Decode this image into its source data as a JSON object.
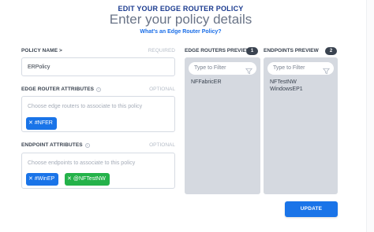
{
  "header": {
    "title": "EDIT YOUR EDGE ROUTER POLICY",
    "subtitle": "Enter your policy details",
    "help_link": "What's an Edge Router Policy?"
  },
  "form": {
    "policy_name": {
      "label": "POLICY NAME >",
      "hint": "REQUIRED",
      "value": "ERPolicy"
    },
    "edge_router_attributes": {
      "label": "EDGE ROUTER ATTRIBUTES",
      "hint": "OPTIONAL",
      "placeholder": "Choose edge routers to associate to this policy",
      "chips": [
        {
          "label": "#NFER",
          "color": "#1a74e8"
        }
      ]
    },
    "endpoint_attributes": {
      "label": "ENDPOINT ATTRIBUTES",
      "hint": "OPTIONAL",
      "placeholder": "Choose endpoints to associate to this policy",
      "chips": [
        {
          "label": "#WinEP",
          "color": "#1a74e8"
        },
        {
          "label": "@NFTestNW",
          "color": "#24b24a"
        }
      ]
    }
  },
  "previews": {
    "edge_routers": {
      "title": "EDGE ROUTERS PREVIEW",
      "count": "1",
      "filter_placeholder": "Type to Filter",
      "items": [
        "NFFabricER"
      ]
    },
    "endpoints": {
      "title": "ENDPOINTS PREVIEW",
      "count": "2",
      "filter_placeholder": "Type to Filter",
      "items": [
        "NFTestNW",
        "WindowsEP1"
      ]
    }
  },
  "actions": {
    "update_label": "UPDATE"
  },
  "colors": {
    "accent": "#1a74e8",
    "green_chip": "#24b24a",
    "panel_bg": "#d5d9e0",
    "title_blue": "#1a3a8f"
  },
  "icons": {
    "info": "info-icon",
    "close": "close-icon",
    "filter": "filter-icon"
  }
}
